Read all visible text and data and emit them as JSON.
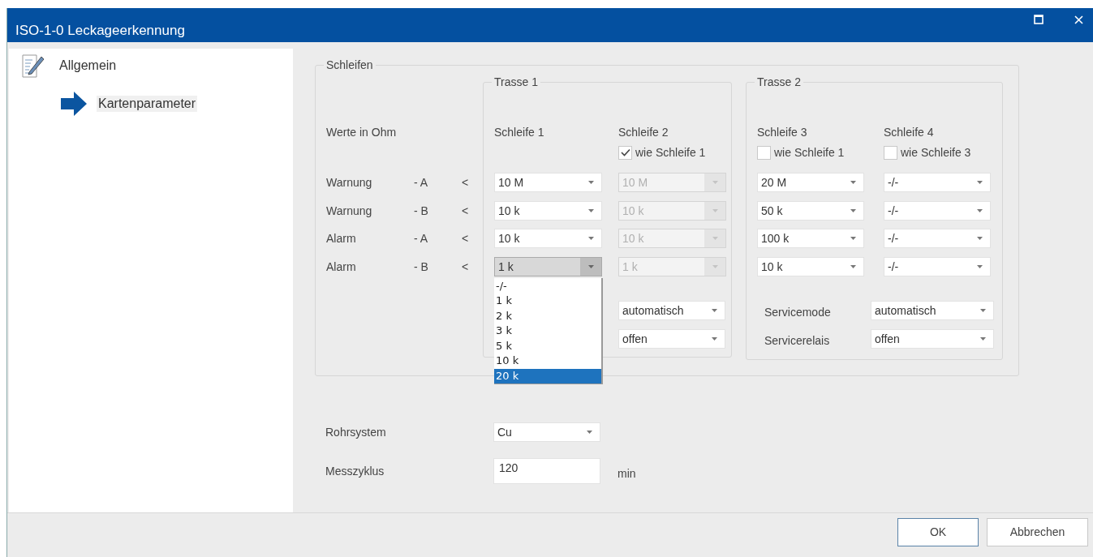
{
  "window": {
    "title": "ISO-1-0 Leckageerkennung"
  },
  "sidebar": {
    "items": [
      {
        "label": "Allgemein",
        "selected": false,
        "children": [
          {
            "label": "Kartenparameter",
            "selected": true
          }
        ]
      }
    ]
  },
  "schleifen": {
    "title": "Schleifen",
    "values_label": "Werte in Ohm",
    "thresholds": [
      {
        "name": "Warnung",
        "side": "- A",
        "operator": "<"
      },
      {
        "name": "Warnung",
        "side": "- B",
        "operator": "<"
      },
      {
        "name": "Alarm",
        "side": "- A",
        "operator": "<"
      },
      {
        "name": "Alarm",
        "side": "- B",
        "operator": "<"
      }
    ],
    "trassen": [
      {
        "title": "Trasse 1",
        "loops": [
          {
            "title": "Schleife 1",
            "values": [
              {
                "value": "10 M",
                "disabled": false
              },
              {
                "value": "10 k",
                "disabled": false
              },
              {
                "value": "10 k",
                "disabled": false
              },
              {
                "value": "1 k",
                "disabled": false,
                "open": true,
                "options": [
                  {
                    "label": "-/-",
                    "highlighted": false
                  },
                  {
                    "label": "1 k",
                    "highlighted": false
                  },
                  {
                    "label": "2 k",
                    "highlighted": false
                  },
                  {
                    "label": "3 k",
                    "highlighted": false
                  },
                  {
                    "label": "5 k",
                    "highlighted": false
                  },
                  {
                    "label": "10 k",
                    "highlighted": false
                  },
                  {
                    "label": "20 k",
                    "highlighted": true
                  }
                ]
              }
            ]
          },
          {
            "title": "Schleife 2",
            "same_as": {
              "label": "wie Schleife 1",
              "checked": true
            },
            "values": [
              {
                "value": "10 M",
                "disabled": true
              },
              {
                "value": "10 k",
                "disabled": true
              },
              {
                "value": "10 k",
                "disabled": true
              },
              {
                "value": "1 k",
                "disabled": true
              }
            ]
          }
        ],
        "service": [
          {
            "value": "automatisch"
          },
          {
            "value": "offen"
          }
        ]
      },
      {
        "title": "Trasse 2",
        "loops": [
          {
            "title": "Schleife 3",
            "same_as": {
              "label": "wie Schleife 1",
              "checked": false
            },
            "values": [
              {
                "value": "20 M",
                "disabled": false
              },
              {
                "value": "50 k",
                "disabled": false
              },
              {
                "value": "100 k",
                "disabled": false
              },
              {
                "value": "10 k",
                "disabled": false
              }
            ]
          },
          {
            "title": "Schleife 4",
            "same_as": {
              "label": "wie Schleife 3",
              "checked": false
            },
            "values": [
              {
                "value": "-/-",
                "disabled": false
              },
              {
                "value": "-/-",
                "disabled": false
              },
              {
                "value": "-/-",
                "disabled": false
              },
              {
                "value": "-/-",
                "disabled": false
              }
            ]
          }
        ],
        "service": [
          {
            "label": "Servicemode",
            "value": "automatisch"
          },
          {
            "label": "Servicerelais",
            "value": "offen"
          }
        ]
      }
    ]
  },
  "rohrsystem": {
    "label": "Rohrsystem",
    "value": "Cu"
  },
  "messzyklus": {
    "label": "Messzyklus",
    "value": "120",
    "unit": "min"
  },
  "buttons": [
    {
      "label": "OK",
      "default": true
    },
    {
      "label": "Abbrechen",
      "default": false
    }
  ]
}
